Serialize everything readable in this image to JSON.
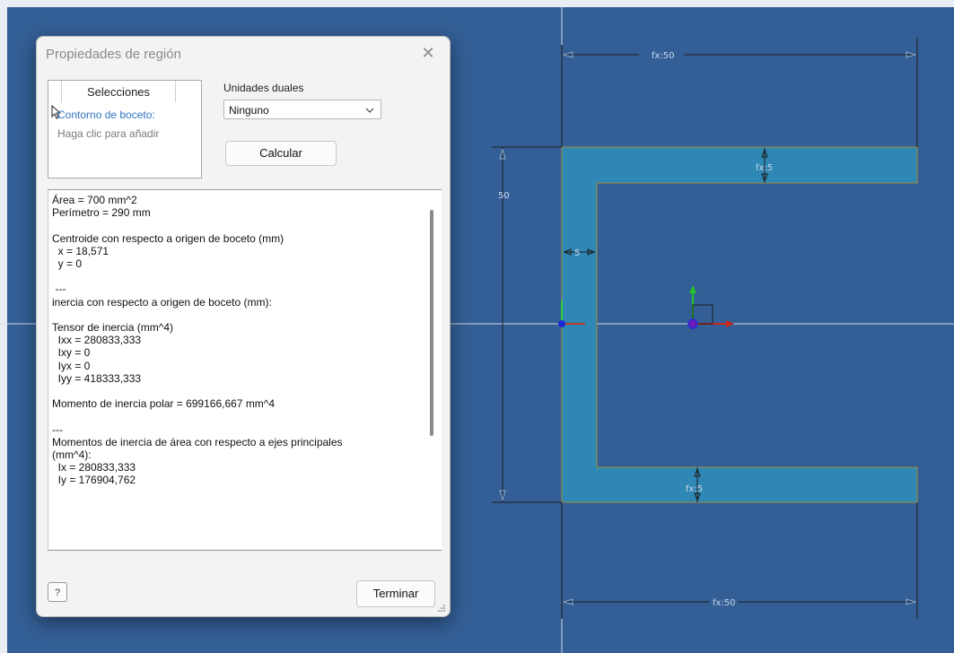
{
  "dialog": {
    "title": "Propiedades de región",
    "close_glyph": "✕",
    "selections": {
      "header": "Selecciones",
      "item": "Contorno de boceto:",
      "add_hint": "Haga clic para añadir"
    },
    "dual_units": {
      "label": "Unidades duales",
      "value": "Ninguno"
    },
    "calculate_label": "Calcular",
    "results_text": "Área = 700 mm^2\nPerímetro = 290 mm\n\nCentroide con respecto a origen de boceto (mm)\n  x = 18,571\n  y = 0\n\n ---\ninercia con respecto a origen de boceto (mm):\n\nTensor de inercia (mm^4)\n  Ixx = 280833,333\n  Ixy = 0\n  Iyx = 0\n  Iyy = 418333,333\n\nMomento de inercia polar = 699166,667 mm^4\n\n---\nMomentos de inercia de área con respecto a ejes principales\n(mm^4):\n  Ix = 280833,333\n  Iy = 176904,762",
    "help_glyph": "?",
    "finish_label": "Terminar"
  },
  "sketch": {
    "dim_top": "fx:50",
    "dim_bottom": "fx:50",
    "dim_height": "50",
    "dim_flange_top": "fx:5",
    "dim_flange_bottom": "fx:5",
    "dim_web": "5",
    "region_color": "#2e87b4",
    "background_color": "#345f96"
  }
}
